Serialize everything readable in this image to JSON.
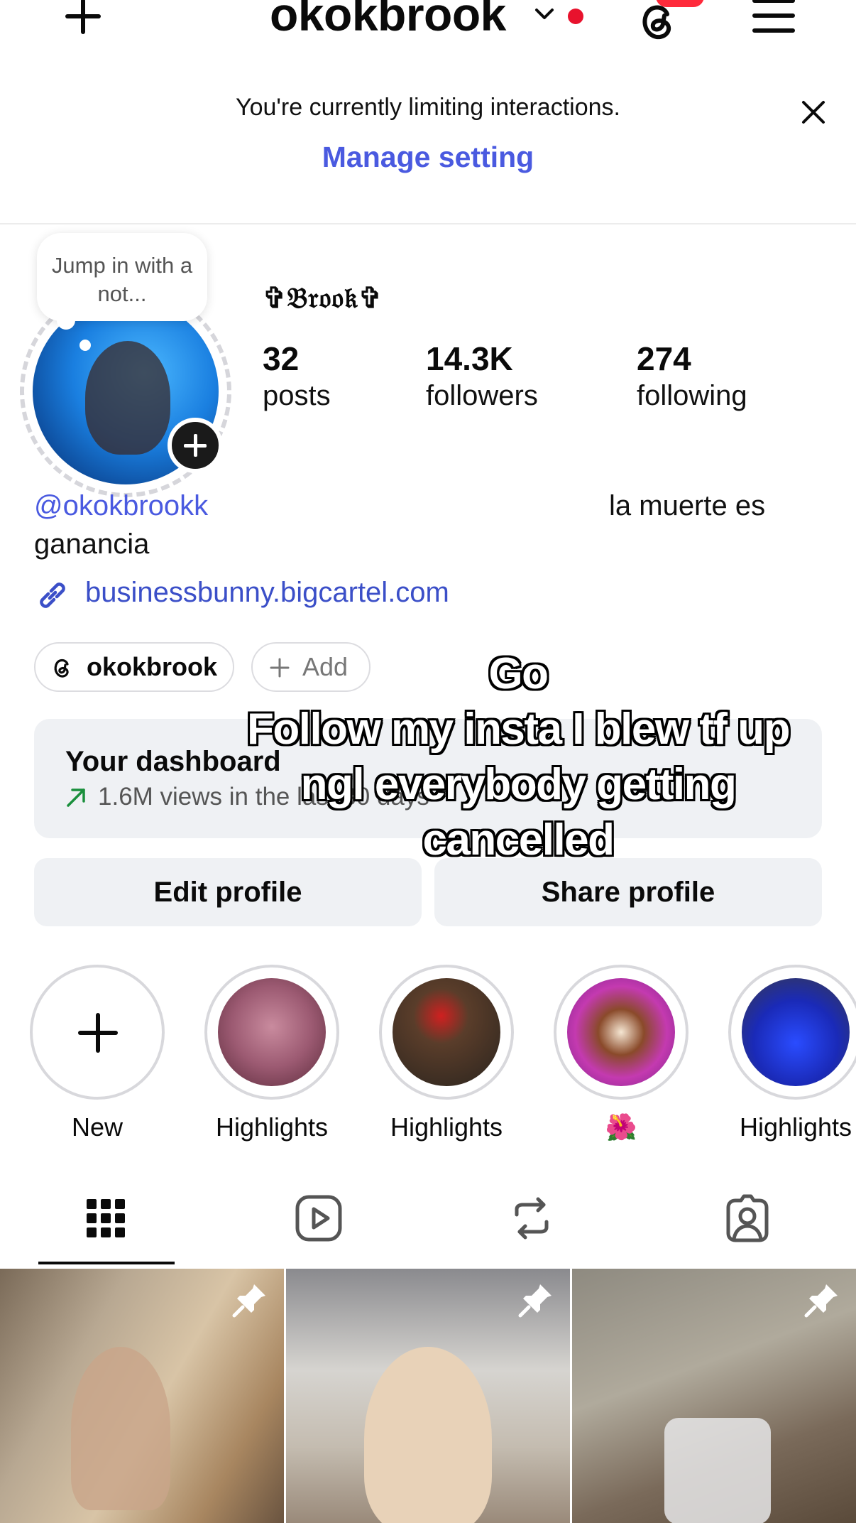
{
  "header": {
    "username": "okokbrook"
  },
  "notice": {
    "text": "You're currently limiting interactions.",
    "link": "Manage setting"
  },
  "profile": {
    "note": "Jump in with a not...",
    "display_name": "✞𝔅𝔯𝔬𝔬𝔨✞",
    "stats": [
      {
        "count": "32",
        "label": "posts"
      },
      {
        "count": "14.3K",
        "label": "followers"
      },
      {
        "count": "274",
        "label": "following"
      }
    ],
    "bio_handle": "@okokbrookk",
    "bio_right": "la muerte es",
    "bio_cont": "ganancia",
    "link": "businessbunny.bigcartel.com",
    "threads_pill": "okokbrook",
    "add_pill": "Add"
  },
  "dashboard": {
    "title": "Your dashboard",
    "subtitle": "1.6M views in the last 30 days"
  },
  "buttons": {
    "edit": "Edit profile",
    "share": "Share profile"
  },
  "caption": {
    "line1": "Go",
    "line2": "Follow my insta I blew tf up ngl  everybody getting cancelled"
  },
  "highlights": [
    {
      "label": "New"
    },
    {
      "label": "Highlights"
    },
    {
      "label": "Highlights"
    },
    {
      "label": "🌺"
    },
    {
      "label": "Highlights"
    }
  ],
  "tabs": [
    "grid-icon",
    "reels-icon",
    "reposts-icon",
    "tagged-icon"
  ],
  "colors": {
    "accent": "#4a5ae0",
    "link": "#3b4fc8",
    "badge": "#e8122d",
    "surface": "#eff1f4"
  }
}
